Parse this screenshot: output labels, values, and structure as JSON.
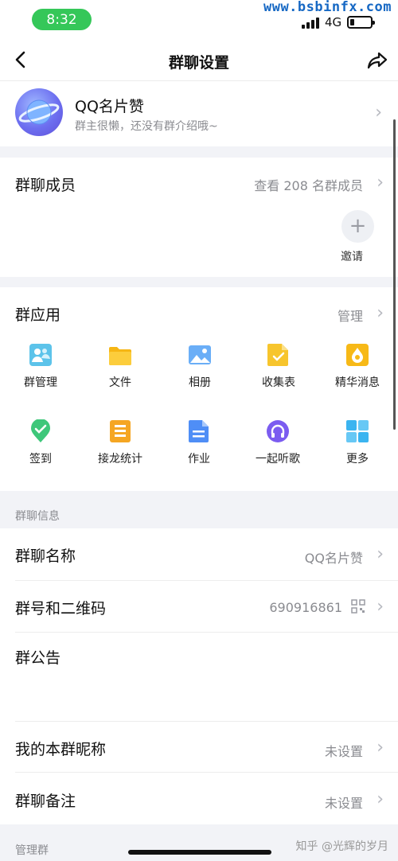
{
  "status_bar": {
    "time": "8:32",
    "network": "4G",
    "watermark": "www.bsbinfx.com"
  },
  "nav": {
    "title": "群聊设置"
  },
  "group": {
    "name": "QQ名片赞",
    "description": "群主很懒，还没有群介绍哦~"
  },
  "members": {
    "title": "群聊成员",
    "view_all": "查看 208 名群成员",
    "invite_label": "邀请"
  },
  "apps": {
    "title": "群应用",
    "manage": "管理",
    "items": [
      {
        "label": "群管理",
        "icon": "group-manage-icon"
      },
      {
        "label": "文件",
        "icon": "folder-icon"
      },
      {
        "label": "相册",
        "icon": "photo-album-icon"
      },
      {
        "label": "收集表",
        "icon": "form-icon"
      },
      {
        "label": "精华消息",
        "icon": "essence-icon"
      },
      {
        "label": "签到",
        "icon": "checkin-icon"
      },
      {
        "label": "接龙统计",
        "icon": "relay-icon"
      },
      {
        "label": "作业",
        "icon": "homework-icon"
      },
      {
        "label": "一起听歌",
        "icon": "music-icon"
      },
      {
        "label": "更多",
        "icon": "more-grid-icon"
      }
    ]
  },
  "info_section_label": "群聊信息",
  "info": {
    "name_label": "群聊名称",
    "name_value": "QQ名片赞",
    "number_label": "群号和二维码",
    "number_value": "690916861",
    "notice_label": "群公告",
    "nickname_label": "我的本群昵称",
    "nickname_value": "未设置",
    "remark_label": "群聊备注",
    "remark_value": "未设置"
  },
  "manage_section_label": "管理群",
  "footer": {
    "zhihu_watermark": "知乎 @光辉的岁月"
  },
  "colors": {
    "accent_green": "#35c759",
    "chevron": "#b6b8bf",
    "secondary_text": "#8a8b90"
  }
}
